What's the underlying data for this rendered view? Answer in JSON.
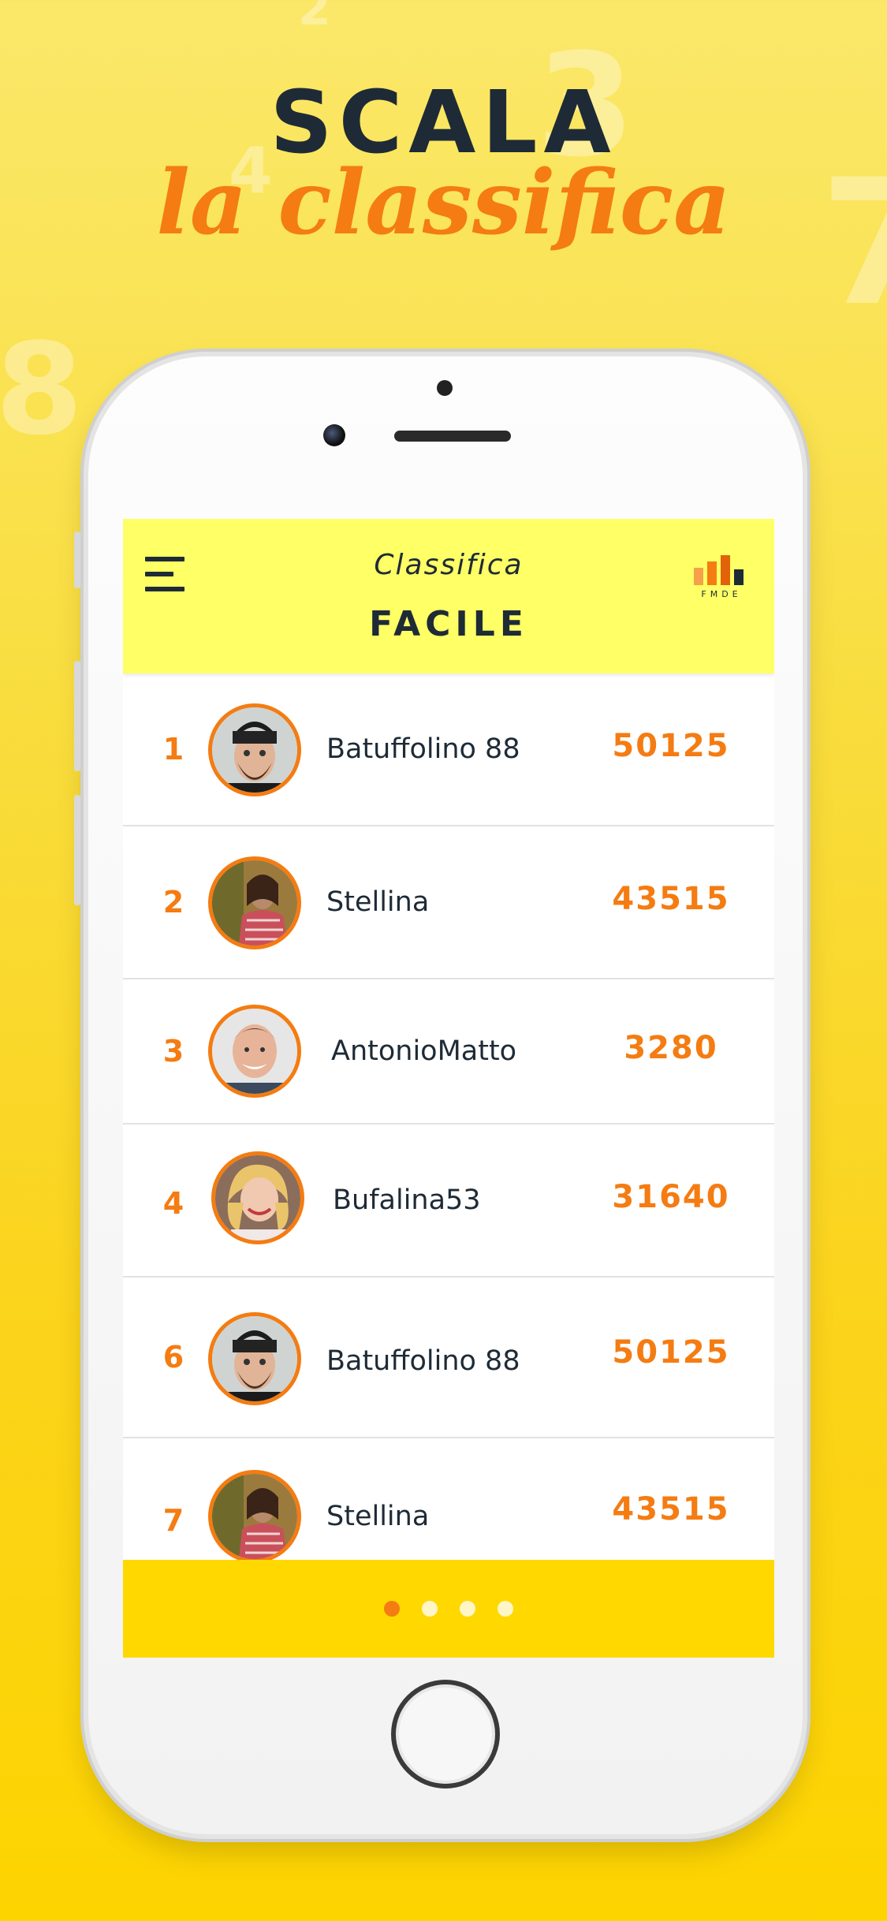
{
  "promo": {
    "title": "SCALA",
    "subtitle": "la classifica"
  },
  "header": {
    "subtitle": "Classifica",
    "title": "FACILE",
    "levels_letters": "FMDE",
    "menu_icon": "hamburger-menu-icon",
    "levels_icon": "difficulty-bars-icon"
  },
  "leaderboard": [
    {
      "rank": "1",
      "name": "Batuffolino 88",
      "score": "50125",
      "avatar": "bearded-man-beanie"
    },
    {
      "rank": "2",
      "name": "Stellina",
      "score": "43515",
      "avatar": "woman-plaid-shirt"
    },
    {
      "rank": "3",
      "name": "AntonioMatto",
      "score": "3280",
      "avatar": "smiling-young-man"
    },
    {
      "rank": "4",
      "name": "Bufalina53",
      "score": "31640",
      "avatar": "blonde-woman"
    },
    {
      "rank": "6",
      "name": "Batuffolino 88",
      "score": "50125",
      "avatar": "bearded-man-beanie"
    },
    {
      "rank": "7",
      "name": "Stellina",
      "score": "43515",
      "avatar": "woman-plaid-shirt"
    }
  ],
  "pager": {
    "count": 4,
    "active": 0
  },
  "colors": {
    "accent": "#f47c12",
    "dark": "#1e2b36",
    "header_bg": "#ffff66",
    "pager_bg": "#ffd800"
  }
}
